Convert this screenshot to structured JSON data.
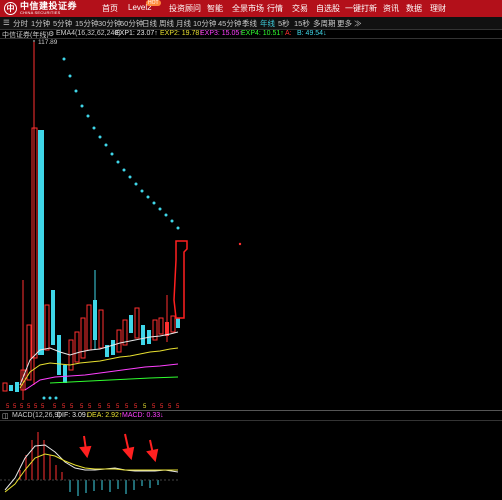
{
  "logo": {
    "mark": "中",
    "name_cn": "中信建投证券",
    "name_en": "CHINA SECURITIES"
  },
  "nav": {
    "items": [
      "首页",
      "Level2",
      "投资顾问",
      "智能",
      "全景市场",
      "行情",
      "交易",
      "自选股",
      "一键打新",
      "资讯",
      "数据",
      "理财"
    ],
    "badge": "HOT"
  },
  "periods": {
    "items": [
      "分时",
      "1分钟",
      "5分钟",
      "15分钟",
      "30分钟",
      "60分钟",
      "日线",
      "周线",
      "月线",
      "10分钟",
      "45分钟",
      "季线",
      "年线",
      "5秒",
      "15秒",
      "多周期",
      "更多"
    ],
    "active": "年线"
  },
  "indicator": {
    "title": "中信证券(年线)",
    "ema_label": "EMA4(16,32,62,240)",
    "exp1": "EXP1: 23.07↑",
    "exp2": "EXP2: 19.78↑",
    "exp3": "EXP3: 15.05↑",
    "exp4": "EXP4: 10.51↑",
    "a": "A:",
    "b": "B: 49.54↓"
  },
  "price_max_label": "117.89",
  "macd": {
    "title": "MACD(12,26,9)",
    "dif": "DIF: 3.09↓",
    "dea": "DEA: 2.92↑",
    "macd": "MACD: 0.33↓"
  },
  "colors": {
    "brand_red": "#b3101a",
    "up": "#ff3030",
    "down": "#3fd6e8",
    "exp1": "#e8e8e8",
    "exp2": "#e8e030",
    "exp3": "#ff40ff",
    "exp4": "#30ff30",
    "dots": "#3fd6e8",
    "highlight_box": "#ff2020"
  },
  "chart_data": {
    "type": "candlestick",
    "period": "年线",
    "price_max": 117.89,
    "dot_trail_count": 26,
    "year_markers": [
      "5",
      "5",
      "5",
      "5",
      "5",
      "5",
      "5",
      "5",
      "5",
      "5",
      "5",
      "5",
      "5",
      "5",
      "5",
      "5",
      "5",
      "5",
      "5",
      "5",
      "5",
      "5",
      "5"
    ]
  }
}
